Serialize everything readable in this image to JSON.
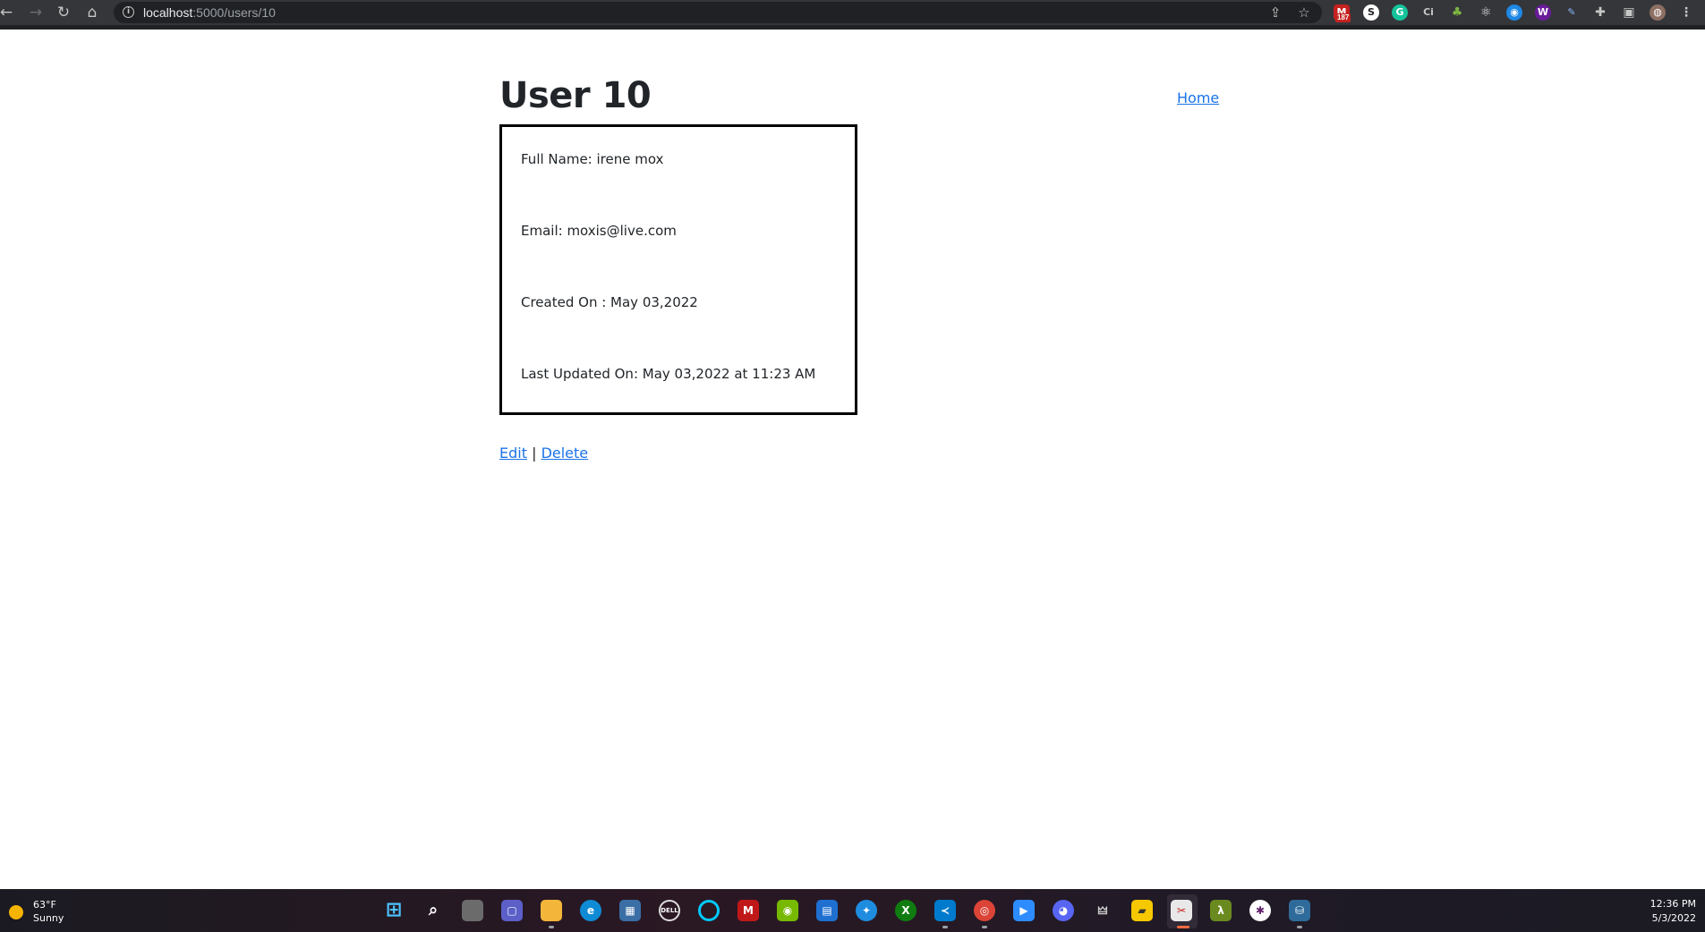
{
  "browser": {
    "url_host": "localhost",
    "url_path": ":5000/users/10",
    "extension_badge": "187"
  },
  "page": {
    "title": "User 10",
    "home_link": "Home",
    "fields": {
      "full_name": "Full Name: irene mox",
      "email": "Email: moxis@live.com",
      "created_on": "Created On : May 03,2022",
      "last_updated": "Last Updated On: May 03,2022 at 11:23 AM"
    },
    "actions": {
      "edit": "Edit",
      "separator": "|",
      "delete": "Delete"
    }
  },
  "taskbar": {
    "weather_temp": "63°F",
    "weather_condition": "Sunny",
    "time": "12:36 PM",
    "date": "5/3/2022"
  },
  "colors": {
    "link": "#1a73e8",
    "browser_bar": "#35363a",
    "card_border": "#000000"
  }
}
